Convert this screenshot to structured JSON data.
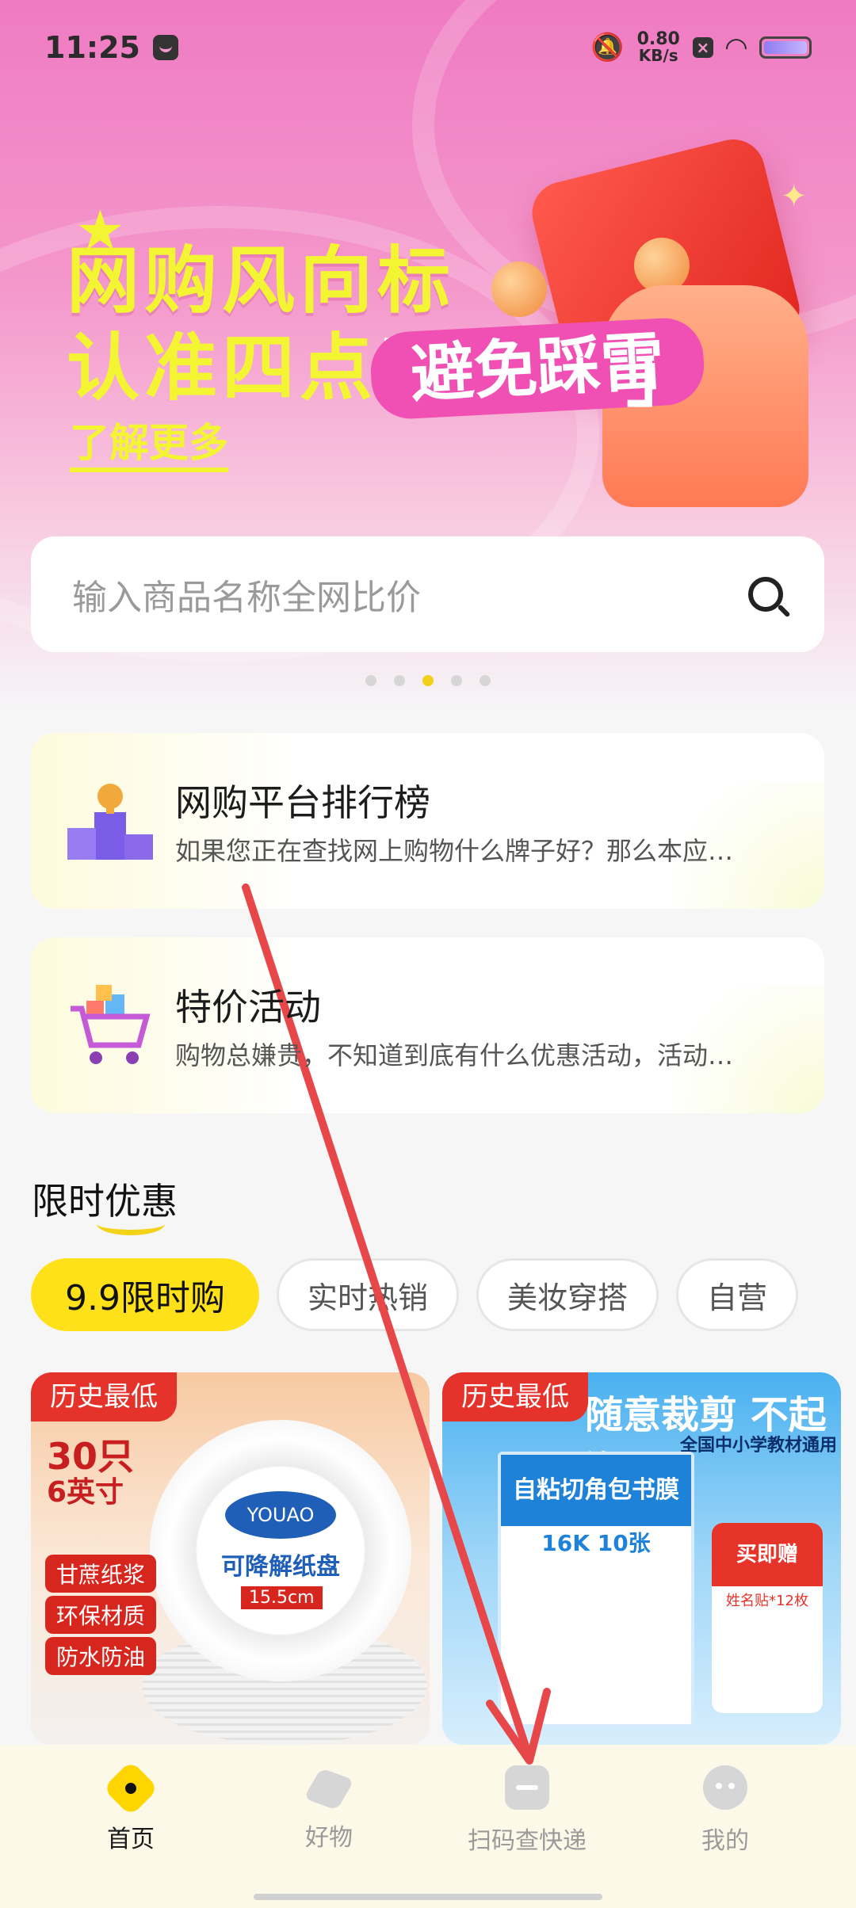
{
  "status_bar": {
    "time": "11:25",
    "net_speed_value": "0.80",
    "net_speed_unit": "KB/s"
  },
  "banner": {
    "line1": "网购风向标",
    "line2_prefix": "认准四点",
    "bracket_open": "「",
    "highlight": "避免踩雷",
    "bracket_close": "」",
    "link": "了解更多",
    "carousel_total": 5,
    "carousel_active": 3
  },
  "search": {
    "placeholder": "输入商品名称全网比价"
  },
  "cards": [
    {
      "title": "网购平台排行榜",
      "desc": "如果您正在查找网上购物什么牌子好？那么本应…",
      "icon": "trophy-podium-icon"
    },
    {
      "title": "特价活动",
      "desc": "购物总嫌贵，不知道到底有什么优惠活动，活动…",
      "icon": "shopping-cart-icon"
    }
  ],
  "deals": {
    "title": "限时优惠",
    "tabs": [
      "9.9限时购",
      "实时热销",
      "美妆穿搭",
      "自营"
    ],
    "active_tab": 0,
    "products": [
      {
        "badge": "历史最低",
        "tags": [
          "甘蔗纸浆",
          "环保材质",
          "防水防油"
        ],
        "brand": "YOUAO",
        "product_name": "可降解纸盘",
        "size": "15.5cm",
        "count": "30只",
        "inch": "6英寸"
      },
      {
        "badge": "历史最低",
        "headline": "随意裁剪 不起泡",
        "sub": "全国中小学教材通用",
        "product_name": "自粘切角包书膜",
        "spec": "16K 10张",
        "gift_title": "买即赠",
        "gift_sub": "姓名贴*12枚"
      }
    ]
  },
  "bottom_nav": {
    "items": [
      {
        "label": "首页",
        "icon": "home-icon",
        "active": true
      },
      {
        "label": "好物",
        "icon": "cube-icon",
        "active": false
      },
      {
        "label": "扫码查快递",
        "icon": "scan-icon",
        "active": false
      },
      {
        "label": "我的",
        "icon": "profile-icon",
        "active": false
      }
    ]
  },
  "colors": {
    "accent": "#ffe11a",
    "banner_pink": "#ef7bc3",
    "banner_text": "#f3f533",
    "badge_red": "#e5322a",
    "annotation_arrow": "#e8474a"
  }
}
